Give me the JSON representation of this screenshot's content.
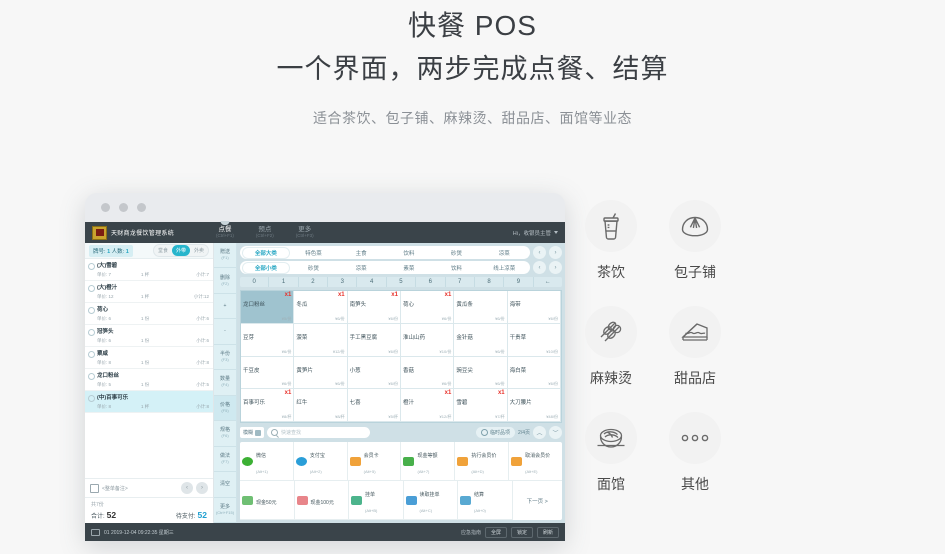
{
  "hero": {
    "title": "快餐 POS",
    "subtitle": "一个界面，两步完成点餐、结算",
    "description": "适合茶饮、包子铺、麻辣烫、甜品店、面馆等业态"
  },
  "app": {
    "brand": "天财商龙餐饮管理系统",
    "nav": [
      {
        "label": "点餐",
        "key": "(Ctrl+F1)",
        "active": true
      },
      {
        "label": "预点",
        "key": "(Ctrl+F2)",
        "active": false
      },
      {
        "label": "更多",
        "key": "(Ctrl+F3)",
        "active": false
      }
    ],
    "user": "Hi，收银员主管",
    "order": {
      "table_label": "牌号:",
      "table_value": "1",
      "people_label": "人数:",
      "people_value": "1",
      "modes": [
        "堂食",
        "外带",
        "外卖"
      ],
      "mode_selected": "外带",
      "items": [
        {
          "name": "(大)雪碧",
          "price": "单价: 7",
          "qty": "1 杯",
          "sub": "小计:7",
          "selected": false
        },
        {
          "name": "(大)橙汁",
          "price": "单价: 12",
          "qty": "1 杯",
          "sub": "小计:12",
          "selected": false
        },
        {
          "name": "荷心",
          "price": "单价: 6",
          "qty": "1 份",
          "sub": "小计:6",
          "selected": false
        },
        {
          "name": "冠笋头",
          "price": "单价: 6",
          "qty": "1 份",
          "sub": "小计:6",
          "selected": false
        },
        {
          "name": "粟咸",
          "price": "单价: 8",
          "qty": "1 份",
          "sub": "小计:8",
          "selected": false
        },
        {
          "name": "龙口粉丝",
          "price": "单价: 5",
          "qty": "1 份",
          "sub": "小计:5",
          "selected": false
        },
        {
          "name": "(中)百事可乐",
          "price": "单价: 8",
          "qty": "1 杯",
          "sub": "小计:8",
          "selected": true
        }
      ],
      "note_placeholder": "<整单备注>",
      "prev_label": "‹",
      "next_label": "›",
      "count_text": "共7份",
      "total_label": "合计:",
      "total_value": "52",
      "due_label": "待支付:",
      "due_value": "52"
    },
    "rail": [
      {
        "label": "赠送",
        "key": "(F1)"
      },
      {
        "label": "删除",
        "key": "(F2)"
      },
      {
        "label": "+",
        "key": ""
      },
      {
        "label": "-",
        "key": ""
      },
      {
        "label": "半份",
        "key": "(F3)"
      },
      {
        "label": "数量",
        "key": "(F4)"
      },
      {
        "label": "价格",
        "key": "(F5)"
      },
      {
        "label": "规格",
        "key": "(F6)"
      },
      {
        "label": "做法",
        "key": "(F7)"
      },
      {
        "label": "清空",
        "key": ""
      },
      {
        "label": "更多",
        "key": "(Ctrl+F15)"
      }
    ],
    "categories_major": [
      "全部大类",
      "特色菜",
      "主食",
      "饮料",
      "砂煲",
      "凉菜"
    ],
    "categories_major_selected": "全部大类",
    "categories_minor": [
      "全部小类",
      "砂煲",
      "凉菜",
      "素菜",
      "饮料",
      "线上凉菜"
    ],
    "categories_minor_selected": "全部小类",
    "numpad": [
      "0",
      "1",
      "2",
      "3",
      "4",
      "5",
      "6",
      "7",
      "8",
      "9",
      "←"
    ],
    "dishes": [
      {
        "name": "龙口粉丝",
        "price": "¥5/份",
        "qty": "x1",
        "selected": true
      },
      {
        "name": "冬瓜",
        "price": "¥6/份",
        "qty": "x1",
        "selected": false
      },
      {
        "name": "南笋头",
        "price": "¥6/份",
        "qty": "x1",
        "selected": false
      },
      {
        "name": "荷心",
        "price": "¥6/份",
        "qty": "x1",
        "selected": false
      },
      {
        "name": "黄瓜条",
        "price": "¥6/份",
        "qty": "",
        "selected": false
      },
      {
        "name": "海带",
        "price": "¥6/份",
        "qty": "",
        "selected": false
      },
      {
        "name": "豆芽",
        "price": "¥6/份",
        "qty": "",
        "selected": false
      },
      {
        "name": "菠菜",
        "price": "¥12/份",
        "qty": "",
        "selected": false
      },
      {
        "name": "手工黑豆腐",
        "price": "¥6/份",
        "qty": "",
        "selected": false
      },
      {
        "name": "淮山山药",
        "price": "¥10/份",
        "qty": "",
        "selected": false
      },
      {
        "name": "金针菇",
        "price": "¥6/份",
        "qty": "",
        "selected": false
      },
      {
        "name": "干贵草",
        "price": "¥10/份",
        "qty": "",
        "selected": false
      },
      {
        "name": "千豆皮",
        "price": "¥6/份",
        "qty": "",
        "selected": false
      },
      {
        "name": "黄笋片",
        "price": "¥6/份",
        "qty": "",
        "selected": false
      },
      {
        "name": "小葱",
        "price": "¥6/份",
        "qty": "",
        "selected": false
      },
      {
        "name": "香菇",
        "price": "¥6/份",
        "qty": "",
        "selected": false
      },
      {
        "name": "豌豆尖",
        "price": "¥6/份",
        "qty": "",
        "selected": false
      },
      {
        "name": "海白菜",
        "price": "¥6/份",
        "qty": "",
        "selected": false
      },
      {
        "name": "百事可乐",
        "price": "¥8/杯",
        "qty": "x1",
        "selected": false
      },
      {
        "name": "红牛",
        "price": "¥8/杯",
        "qty": "",
        "selected": false
      },
      {
        "name": "七喜",
        "price": "¥5/杯",
        "qty": "",
        "selected": false
      },
      {
        "name": "橙汁",
        "price": "¥12/杯",
        "qty": "x1",
        "selected": false
      },
      {
        "name": "雪碧",
        "price": "¥7/杯",
        "qty": "x1",
        "selected": false
      },
      {
        "name": "大刀腰片",
        "price": "¥48/份",
        "qty": "",
        "selected": false
      }
    ],
    "search": {
      "filter_label": "模糊",
      "placeholder": "快速查找",
      "temp_item_label": "临时品项",
      "page_label": "2/4页",
      "up_label": "︿",
      "down_label": "﹀"
    },
    "payments_row1": [
      {
        "label": "微信",
        "key": "(Alt+1)",
        "color": "#3cb034"
      },
      {
        "label": "支付宝",
        "key": "(Alt+2)",
        "color": "#2a9ed8"
      },
      {
        "label": "会员卡",
        "key": "(Alt+5)",
        "color": "#f0a23a"
      },
      {
        "label": "现金等额",
        "key": "(Alt+7)",
        "color": "#48b04b"
      },
      {
        "label": "执行会员价",
        "key": "(Alt+D)",
        "color": "#f0a23a"
      },
      {
        "label": "取消会员价",
        "key": "(Alt+E)",
        "color": "#f0a23a"
      }
    ],
    "payments_row2": [
      {
        "label": "现金50元",
        "key": "",
        "color": "#6fbf73"
      },
      {
        "label": "现金100元",
        "key": "",
        "color": "#e8858a"
      },
      {
        "label": "挂单",
        "key": "(Alt+B)",
        "color": "#4cb48c"
      },
      {
        "label": "读取挂单",
        "key": "(Alt+C)",
        "color": "#4a9ed6"
      },
      {
        "label": "结算",
        "key": "(Alt+0)",
        "color": "#59a9d2"
      }
    ],
    "next_page_label": "下一页 >",
    "statusbar": {
      "text": "01 2019-12-04 09:22:35 星期三",
      "guide": "应急指南",
      "buttons": [
        "全屏",
        "锁定",
        "刷新"
      ]
    }
  },
  "icon_grid": [
    [
      {
        "label": "茶饮",
        "icon": "drink-cup-icon"
      },
      {
        "label": "包子铺",
        "icon": "steamed-bun-icon"
      }
    ],
    [
      {
        "label": "麻辣烫",
        "icon": "skewer-icon"
      },
      {
        "label": "甜品店",
        "icon": "cake-slice-icon"
      }
    ],
    [
      {
        "label": "面馆",
        "icon": "noodle-bowl-icon"
      },
      {
        "label": "其他",
        "icon": "more-dots-icon"
      }
    ]
  ]
}
